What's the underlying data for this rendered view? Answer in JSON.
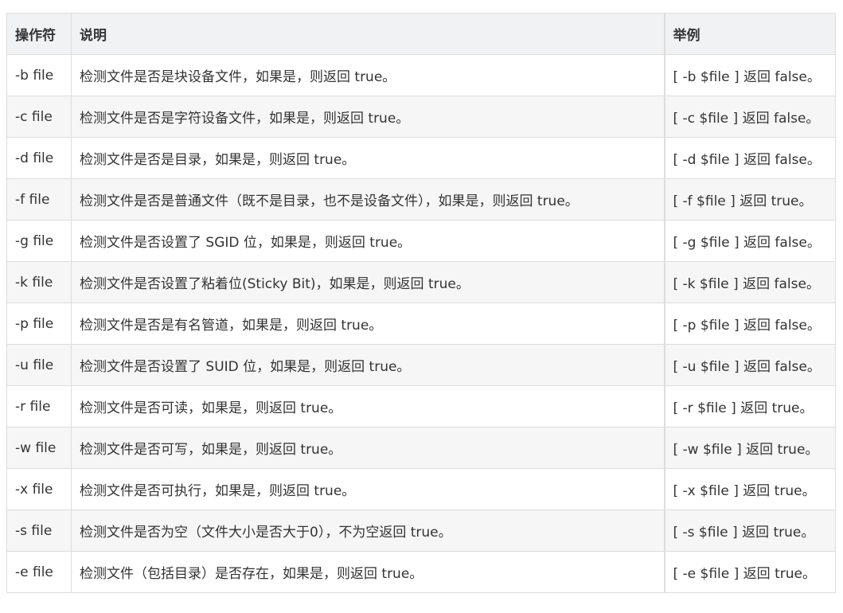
{
  "table": {
    "headers": [
      "操作符",
      "说明",
      "举例"
    ],
    "rows": [
      [
        "-b file",
        "检测文件是否是块设备文件，如果是，则返回 true。",
        "[ -b $file ] 返回 false。"
      ],
      [
        "-c file",
        "检测文件是否是字符设备文件，如果是，则返回 true。",
        "[ -c $file ] 返回 false。"
      ],
      [
        "-d file",
        "检测文件是否是目录，如果是，则返回 true。",
        "[ -d $file ] 返回 false。"
      ],
      [
        "-f file",
        "检测文件是否是普通文件（既不是目录，也不是设备文件），如果是，则返回 true。",
        "[ -f $file ] 返回 true。"
      ],
      [
        "-g file",
        "检测文件是否设置了 SGID 位，如果是，则返回 true。",
        "[ -g $file ] 返回 false。"
      ],
      [
        "-k file",
        "检测文件是否设置了粘着位(Sticky Bit)，如果是，则返回 true。",
        "[ -k $file ] 返回 false。"
      ],
      [
        "-p file",
        "检测文件是否是有名管道，如果是，则返回 true。",
        "[ -p $file ] 返回 false。"
      ],
      [
        "-u file",
        "检测文件是否设置了 SUID 位，如果是，则返回 true。",
        "[ -u $file ] 返回 false。"
      ],
      [
        "-r file",
        "检测文件是否可读，如果是，则返回 true。",
        "[ -r $file ] 返回 true。"
      ],
      [
        "-w file",
        "检测文件是否可写，如果是，则返回 true。",
        "[ -w $file ] 返回 true。"
      ],
      [
        "-x file",
        "检测文件是否可执行，如果是，则返回 true。",
        "[ -x $file ] 返回 true。"
      ],
      [
        "-s file",
        "检测文件是否为空（文件大小是否大于0），不为空返回 true。",
        "[ -s $file ] 返回 true。"
      ],
      [
        "-e file",
        "检测文件（包括目录）是否存在，如果是，则返回 true。",
        "[ -e $file ] 返回 true。"
      ]
    ]
  }
}
